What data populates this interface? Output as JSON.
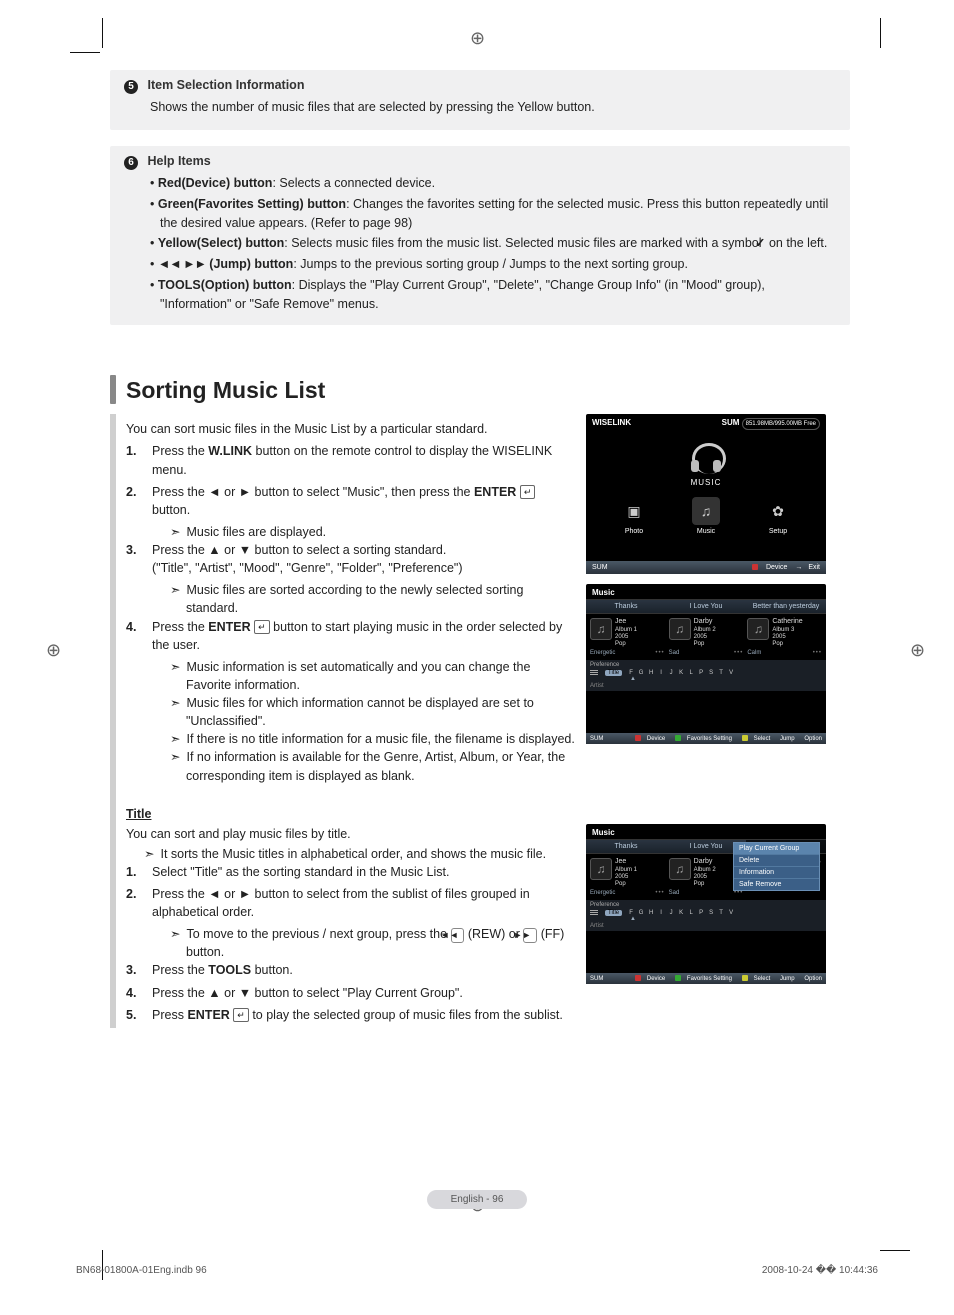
{
  "box5": {
    "num": "5",
    "title": "Item Selection Information",
    "desc": "Shows the number of music files that are selected by pressing the Yellow button."
  },
  "box6": {
    "num": "6",
    "title": "Help Items",
    "bullets": {
      "red_b": "Red(Device) button",
      "red_t": ": Selects a connected device.",
      "green_b": "Green(Favorites Setting) button",
      "green_t": ": Changes the favorites setting for the selected music. Press this button repeatedly until the desired value appears. (Refer to page 98)",
      "yellow_b": "Yellow(Select) button",
      "yellow_t1": ": Selects music files from the music list. Selected music files are marked with a symbol ",
      "yellow_t2": " on the left.",
      "jump_sym": "◄◄ ►►",
      "jump_b": " (Jump) button",
      "jump_t": ": Jumps to the previous sorting group / Jumps to the next sorting group.",
      "tools_b": "TOOLS(Option) button",
      "tools_t": ": Displays the \"Play Current Group\", \"Delete\", \"Change Group Info\" (in \"Mood\" group), \"Information\" or \"Safe Remove\" menus."
    }
  },
  "section": {
    "title": "Sorting Music List"
  },
  "main": {
    "intro": "You can sort music files in the Music List by a particular standard.",
    "s1a": "Press the ",
    "s1b": "W.LINK",
    "s1c": " button on the remote control to display the WISELINK menu.",
    "s2a": "Press the ◄ or ► button to select \"Music\", then press the ",
    "s2b": "ENTER",
    "s2c": " button.",
    "s2sub": "Music files are displayed.",
    "s3a": "Press the ▲ or ▼ button to select a sorting standard.",
    "s3b": "(\"Title\", \"Artist\", \"Mood\", \"Genre\", \"Folder\", \"Preference\")",
    "s3sub": "Music files are sorted according to the newly selected sorting standard.",
    "s4a": "Press the ",
    "s4b": "ENTER",
    "s4c": " button to start playing music in the order selected by the user.",
    "s4sub1": "Music information is set automatically and you can change the Favorite information.",
    "s4sub2": "Music files for which information cannot be displayed are set to \"Unclassified\".",
    "s4sub3": "If there is no title information for a music file, the filename is displayed.",
    "s4sub4": "If no information is available for the Genre, Artist, Album, or Year, the corresponding item is displayed as blank.",
    "ditto": "➣"
  },
  "title_section": {
    "heading": "Title",
    "intro": "You can sort and play music files by title.",
    "sub0": "It sorts the Music titles in alphabetical order, and shows the music file.",
    "s1": "Select \"Title\" as the sorting standard in the Music List.",
    "s2a": "Press the ◄ or ► button to select from the sublist of files grouped in alphabetical order.",
    "s2sub_a": "To move to the previous / next group, press the ",
    "s2sub_b": " (REW) or ",
    "s2sub_c": " (FF) button.",
    "s3a": "Press the ",
    "s3b": "TOOLS",
    "s3c": " button.",
    "s4": "Press the ▲ or ▼ button to select \"Play Current Group\".",
    "s5a": "Press ",
    "s5b": "ENTER",
    "s5c": " to play the selected group of music files from the sublist."
  },
  "glyphs": {
    "check": "✓",
    "enter": "↵",
    "rew": "◄◄",
    "ff": "►►"
  },
  "wiselink": {
    "title": "WISELINK",
    "sum": "SUM",
    "cap": "851.98MB/995.00MB Free",
    "music": "MUSIC",
    "t_photo": "Photo",
    "t_music": "Music",
    "t_setup": "Setup",
    "bot_l": "SUM",
    "bot_device": "Device",
    "bot_exit": "Exit"
  },
  "music_shot": {
    "head": "Music",
    "tabs": [
      "Thanks",
      "I Love You",
      "Better than yesterday"
    ],
    "items": [
      {
        "name": "Jee",
        "album": "Album 1",
        "year": "2005",
        "genre": "Pop",
        "mood": "Energetic"
      },
      {
        "name": "Darby",
        "album": "Album 2",
        "year": "2005",
        "genre": "Pop",
        "mood": "Sad"
      },
      {
        "name": "Catherine",
        "album": "Album 3",
        "year": "2005",
        "genre": "Pop",
        "mood": "Calm"
      }
    ],
    "sort": {
      "pref": "Preference",
      "title": "Title",
      "artist": "Artist",
      "letters": [
        "F",
        "G",
        "H",
        "I",
        "J",
        "K",
        "L",
        "P",
        "S",
        "T",
        "V"
      ]
    },
    "bot": {
      "sum": "SUM",
      "device": "Device",
      "fav": "Favorites Setting",
      "select": "Select",
      "jump": "Jump",
      "option": "Option"
    }
  },
  "popup": {
    "items": [
      "Play Current Group",
      "Delete",
      "Information",
      "Safe Remove"
    ]
  },
  "footer": {
    "page": "English - 96",
    "file": "BN68-01800A-01Eng.indb   96",
    "stamp": "2008-10-24   �� 10:44:36"
  }
}
